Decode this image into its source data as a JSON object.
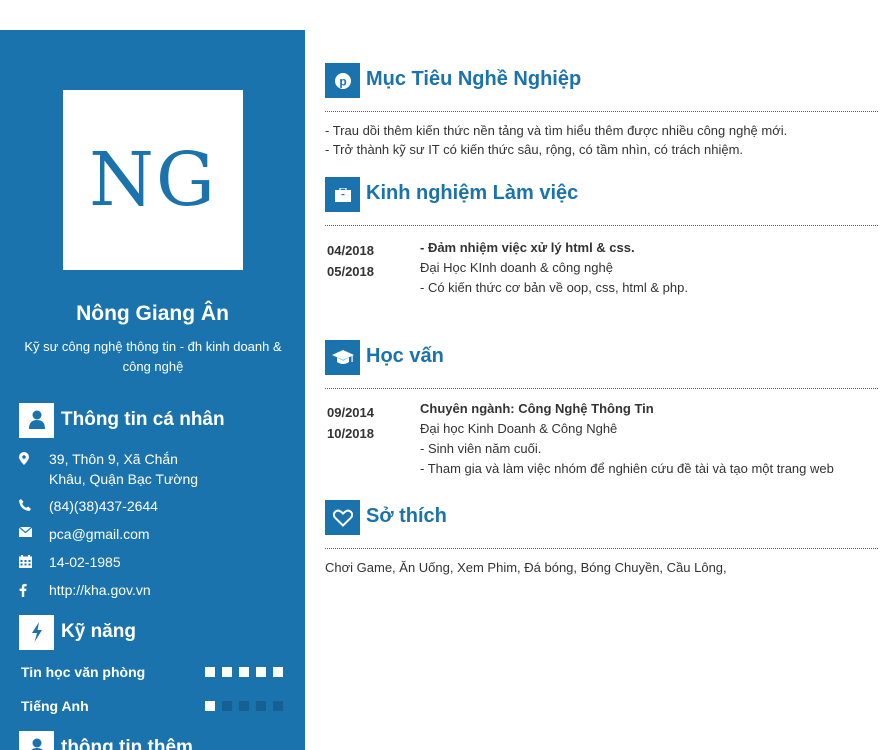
{
  "profile": {
    "initials": "NG",
    "name": "Nông Giang Ân",
    "title": "Kỹ sư công nghệ thông tin - đh kinh doanh & công nghệ"
  },
  "personal": {
    "heading": "Thông tin cá nhân",
    "address": "39, Thôn 9, Xã Chắn Khâu, Quận Bạc Tường",
    "phone": "(84)(38)437-2644",
    "email": "pca@gmail.com",
    "dob": "14-02-1985",
    "website": "http://kha.gov.vn"
  },
  "skills": {
    "heading": "Kỹ năng",
    "items": [
      {
        "label": "Tin học văn phòng",
        "level": 5,
        "max": 5
      },
      {
        "label": "Tiếng Anh",
        "level": 1,
        "max": 5
      }
    ]
  },
  "extra": {
    "heading": "thông tin thêm"
  },
  "objective": {
    "heading": "Mục Tiêu Nghề Nghiệp",
    "lines": [
      "- Trau dồi thêm kiến thức nền tảng và tìm hiểu thêm được nhiều công nghệ mới.",
      "- Trở thành kỹ sư IT có kiến thức sâu, rộng, có tầm nhìn, có trách nhiệm."
    ]
  },
  "experience": {
    "heading": "Kinh nghiệm Làm việc",
    "start": "04/2018",
    "end": "05/2018",
    "role": "- Đảm nhiệm việc xử lý html & css.",
    "org": "Đại Học KInh doanh & công nghệ",
    "desc": "- Có kiến thức cơ bản về oop, css, html & php."
  },
  "education": {
    "heading": "Học vấn",
    "start": "09/2014",
    "end": "10/2018",
    "major": "Chuyên ngành: Công Nghệ Thông Tin",
    "school": "Đại học Kinh Doanh & Công Nghê",
    "notes": [
      "- Sinh viên năm cuối.",
      "- Tham gia và làm việc nhóm để nghiên cứu đề tài và tạo một trang web"
    ]
  },
  "hobbies": {
    "heading": "Sở thích",
    "text": "Chơi Game, Ăn Uống, Xem Phim, Đá bóng, Bóng Chuyền, Cầu Lông,"
  },
  "colors": {
    "accent": "#1a73ad",
    "dot_off": "#155f92"
  }
}
